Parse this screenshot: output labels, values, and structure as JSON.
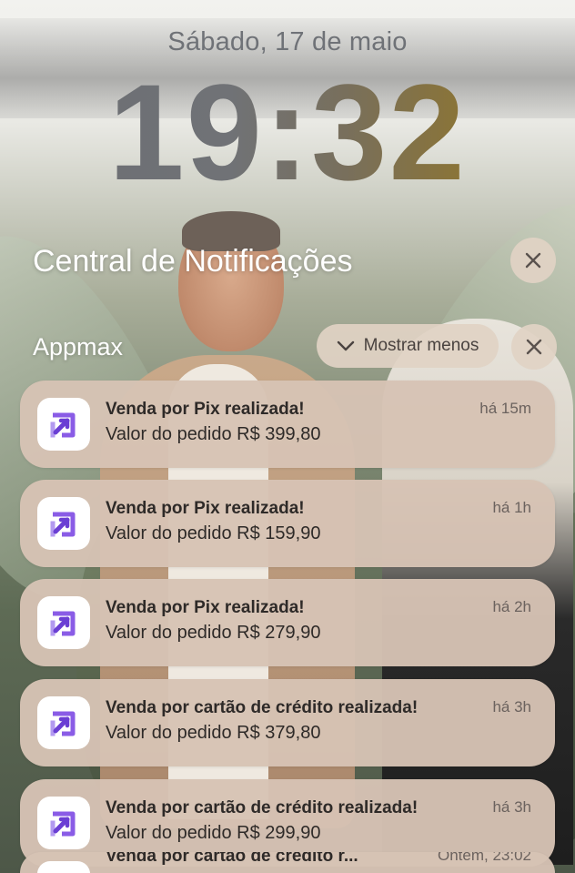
{
  "lockscreen": {
    "date": "Sábado, 17 de maio",
    "time": "19:32"
  },
  "notification_center": {
    "title": "Central de Notificações",
    "close_icon": "close-icon"
  },
  "group": {
    "app_name": "Appmax",
    "show_less_label": "Mostrar menos",
    "show_less_icon": "chevron-down-icon",
    "close_icon": "close-icon"
  },
  "notifications": [
    {
      "app_icon": "appmax-icon",
      "title": "Venda por Pix realizada!",
      "body": "Valor do pedido R$ 399,80",
      "time": "há 15m"
    },
    {
      "app_icon": "appmax-icon",
      "title": "Venda por Pix realizada!",
      "body": "Valor do pedido R$ 159,90",
      "time": "há 1h"
    },
    {
      "app_icon": "appmax-icon",
      "title": "Venda por Pix realizada!",
      "body": "Valor do pedido R$ 279,90",
      "time": "há 2h"
    },
    {
      "app_icon": "appmax-icon",
      "title": "Venda por cartão de crédito realizada!",
      "body": "Valor do pedido R$ 379,80",
      "time": "há 3h"
    },
    {
      "app_icon": "appmax-icon",
      "title": "Venda por cartão de crédito realizada!",
      "body": "Valor do pedido R$ 299,90",
      "time": "há 3h"
    },
    {
      "app_icon": "appmax-icon",
      "title": "Venda por cartão de crédito r...",
      "body": "",
      "time": "Ontem, 23:02"
    }
  ],
  "colors": {
    "card_bg": "#d6c3b4",
    "icon_purple": "#7b4fd9",
    "text_dark": "#2e2a28"
  }
}
